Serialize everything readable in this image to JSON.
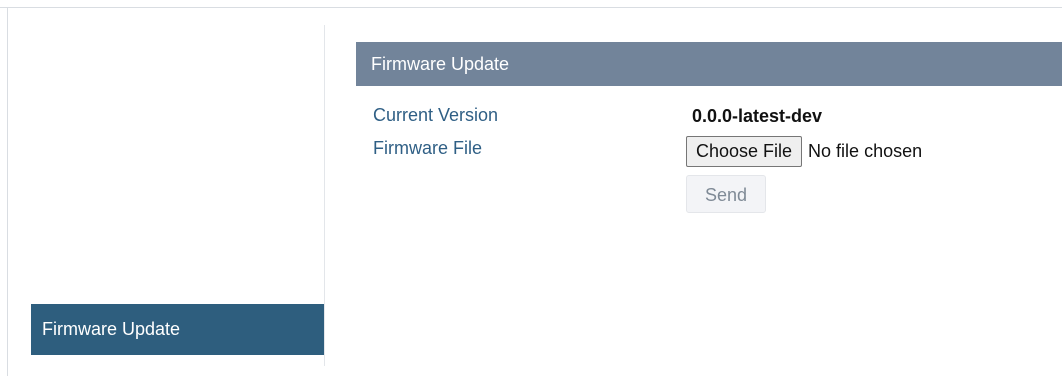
{
  "sidebar": {
    "items": [
      {
        "label": "Firmware Update",
        "active": true
      }
    ]
  },
  "panel": {
    "title": "Firmware Update"
  },
  "fields": {
    "current_version_label": "Current Version",
    "current_version_value": "0.0.0-latest-dev",
    "firmware_file_label": "Firmware File"
  },
  "file_input": {
    "button_label": "Choose File",
    "status": "No file chosen"
  },
  "actions": {
    "send_label": "Send",
    "send_disabled": true
  },
  "colors": {
    "sidebar_active_bg": "#2e5e7e",
    "panel_header_bg": "#72849a",
    "label_text": "#2f5f85"
  }
}
